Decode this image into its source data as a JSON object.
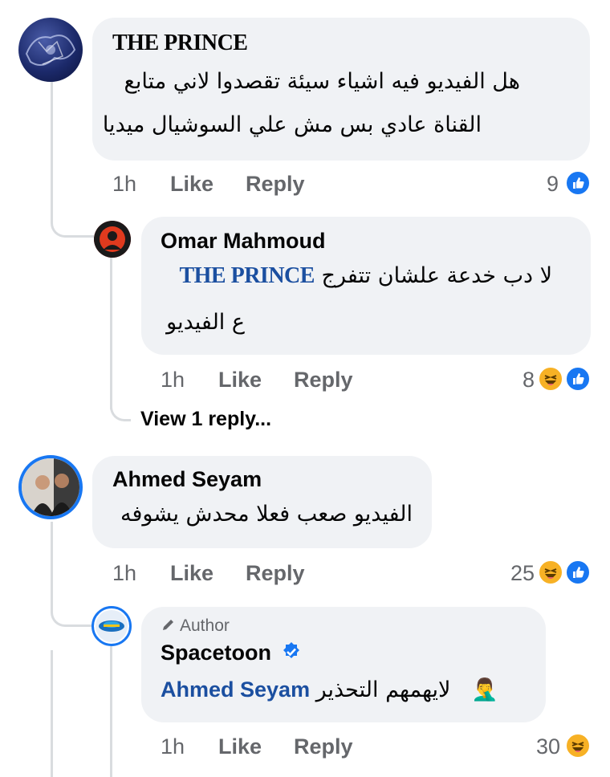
{
  "comments": [
    {
      "author": "THE PRINCE",
      "text_line1": "هل الفيديو فيه اشياء سيئة تقصدوا لاني متابع",
      "text_line2": "القناة عادي بس مش علي السوشيال ميديا",
      "time": "1h",
      "like_label": "Like",
      "reply_label": "Reply",
      "reaction_count": "9",
      "reactions": [
        "like-icon"
      ]
    },
    {
      "author": "Omar Mahmoud",
      "mention": "THE PRINCE",
      "text_line1": "لا دب خدعة علشان تتفرج",
      "text_line2": "ع الفيديو",
      "time": "1h",
      "like_label": "Like",
      "reply_label": "Reply",
      "reaction_count": "8",
      "reactions": [
        "haha-icon",
        "like-icon"
      ],
      "view_replies": "View 1 reply..."
    },
    {
      "author": "Ahmed Seyam",
      "text_line1": "الفيديو صعب فعلا محدش يشوفه",
      "time": "1h",
      "like_label": "Like",
      "reply_label": "Reply",
      "reaction_count": "25",
      "reactions": [
        "haha-icon",
        "like-icon"
      ]
    },
    {
      "badge": "Author",
      "author": "Spacetoon",
      "verified": true,
      "mention": "Ahmed Seyam",
      "text": "لايهمهم التحذير",
      "emoji": "🤦‍♂️",
      "time": "1h",
      "like_label": "Like",
      "reply_label": "Reply",
      "reaction_count": "30",
      "reactions": [
        "haha-icon"
      ]
    }
  ],
  "colors": {
    "bubble": "#f0f2f5",
    "like": "#1877f2",
    "haha": "#f7b125",
    "meta": "#65676b",
    "mention": "#1b4fa0"
  }
}
